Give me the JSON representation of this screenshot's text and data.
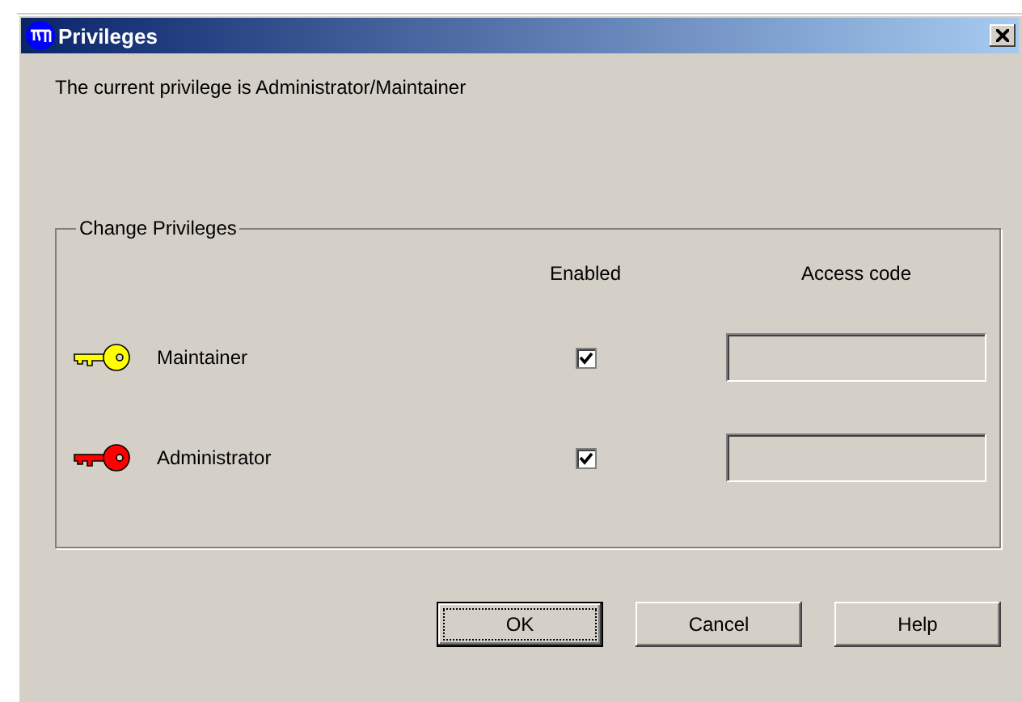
{
  "window": {
    "title": "Privileges"
  },
  "message": "The current privilege is Administrator/Maintainer",
  "group": {
    "title": "Change Privileges",
    "columns": [
      "Enabled",
      "Access code"
    ],
    "rows": [
      {
        "name": "Maintainer",
        "color": "#ffff00",
        "enabled": true,
        "access_code": ""
      },
      {
        "name": "Administrator",
        "color": "#ff0000",
        "enabled": true,
        "access_code": ""
      }
    ]
  },
  "buttons": [
    {
      "label": "OK",
      "default": true
    },
    {
      "label": "Cancel",
      "default": false
    },
    {
      "label": "Help",
      "default": false
    }
  ]
}
